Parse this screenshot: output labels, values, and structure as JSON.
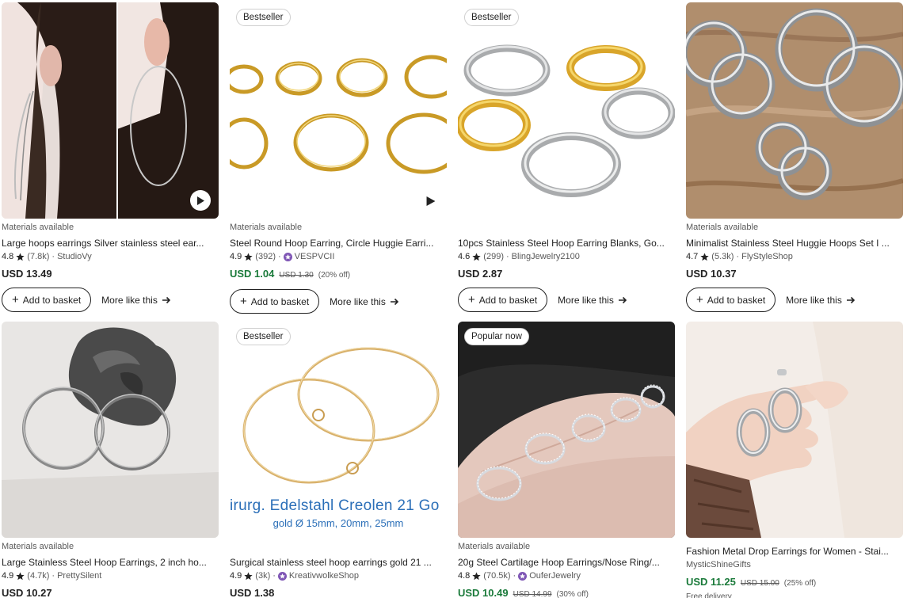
{
  "listings": [
    {
      "badge": "",
      "tagline": "Materials available",
      "title": "Large hoops earrings Silver stainless steel ear...",
      "rating": "4.8",
      "reviews": "(7.8k)",
      "sep": "·",
      "shop": "StudioVy",
      "star_seller": false,
      "price": "USD 13.49",
      "original_price": "",
      "discount": "",
      "delivery": "",
      "add_label": "Add to basket",
      "more_label": "More like this"
    },
    {
      "badge": "Bestseller",
      "tagline": "Materials available",
      "title": "Steel Round Hoop Earring, Circle Huggie Earri...",
      "rating": "4.9",
      "reviews": "(392)",
      "sep": "·",
      "shop": "VESPVCII",
      "star_seller": true,
      "price": "USD 1.04",
      "original_price": "USD 1.30",
      "discount": "(20% off)",
      "delivery": "",
      "add_label": "Add to basket",
      "more_label": "More like this"
    },
    {
      "badge": "Bestseller",
      "tagline": "",
      "title": "10pcs Stainless Steel Hoop Earring Blanks, Go...",
      "rating": "4.6",
      "reviews": "(299)",
      "sep": "·",
      "shop": "BlingJewelry2100",
      "star_seller": false,
      "price": "USD 2.87",
      "original_price": "",
      "discount": "",
      "delivery": "",
      "add_label": "Add to basket",
      "more_label": "More like this"
    },
    {
      "badge": "",
      "tagline": "Materials available",
      "title": "Minimalist Stainless Steel Huggie Hoops Set I ...",
      "rating": "4.7",
      "reviews": "(5.3k)",
      "sep": "·",
      "shop": "FlyStyleShop",
      "star_seller": false,
      "price": "USD 10.37",
      "original_price": "",
      "discount": "",
      "delivery": "",
      "add_label": "Add to basket",
      "more_label": "More like this"
    },
    {
      "badge": "",
      "tagline": "Materials available",
      "title": "Large Stainless Steel Hoop Earrings, 2 inch ho...",
      "rating": "4.9",
      "reviews": "(4.7k)",
      "sep": "·",
      "shop": "PrettySilent",
      "star_seller": false,
      "price": "USD 10.27",
      "original_price": "",
      "discount": "",
      "delivery": ""
    },
    {
      "badge": "Bestseller",
      "tagline": "",
      "title": "Surgical stainless steel hoop earrings gold 21 ...",
      "rating": "4.9",
      "reviews": "(3k)",
      "sep": "·",
      "shop": "KreativwolkeShop",
      "star_seller": true,
      "price": "USD 1.38",
      "original_price": "",
      "discount": "",
      "delivery": "",
      "image_text_1": "irurg. Edelstahl Creolen 21 Go",
      "image_text_2": "gold Ø 15mm, 20mm, 25mm"
    },
    {
      "badge": "Popular now",
      "tagline": "Materials available",
      "title": "20g Steel Cartilage Hoop Earrings/Nose Ring/...",
      "rating": "4.8",
      "reviews": "(70.5k)",
      "sep": "·",
      "shop": "OuferJewelry",
      "star_seller": true,
      "price": "USD 10.49",
      "original_price": "USD 14.99",
      "discount": "(30% off)",
      "delivery": ""
    },
    {
      "badge": "",
      "tagline": "",
      "title": "Fashion Metal Drop Earrings for Women - Stai...",
      "rating": "",
      "reviews": "",
      "sep": "",
      "shop": "MysticShineGifts",
      "star_seller": false,
      "price": "USD 11.25",
      "original_price": "USD 15.00",
      "discount": "(25% off)",
      "delivery": "Free delivery"
    }
  ],
  "colors": {
    "sale_price": "#1a7a3a",
    "star_seller_badge": "#7f56b5",
    "text": "#222222",
    "muted": "#595959"
  },
  "icons": {
    "rating": "star-icon",
    "seller": "star-seller-icon",
    "play": "play-icon",
    "add": "plus-icon",
    "more": "arrow-right-icon"
  }
}
